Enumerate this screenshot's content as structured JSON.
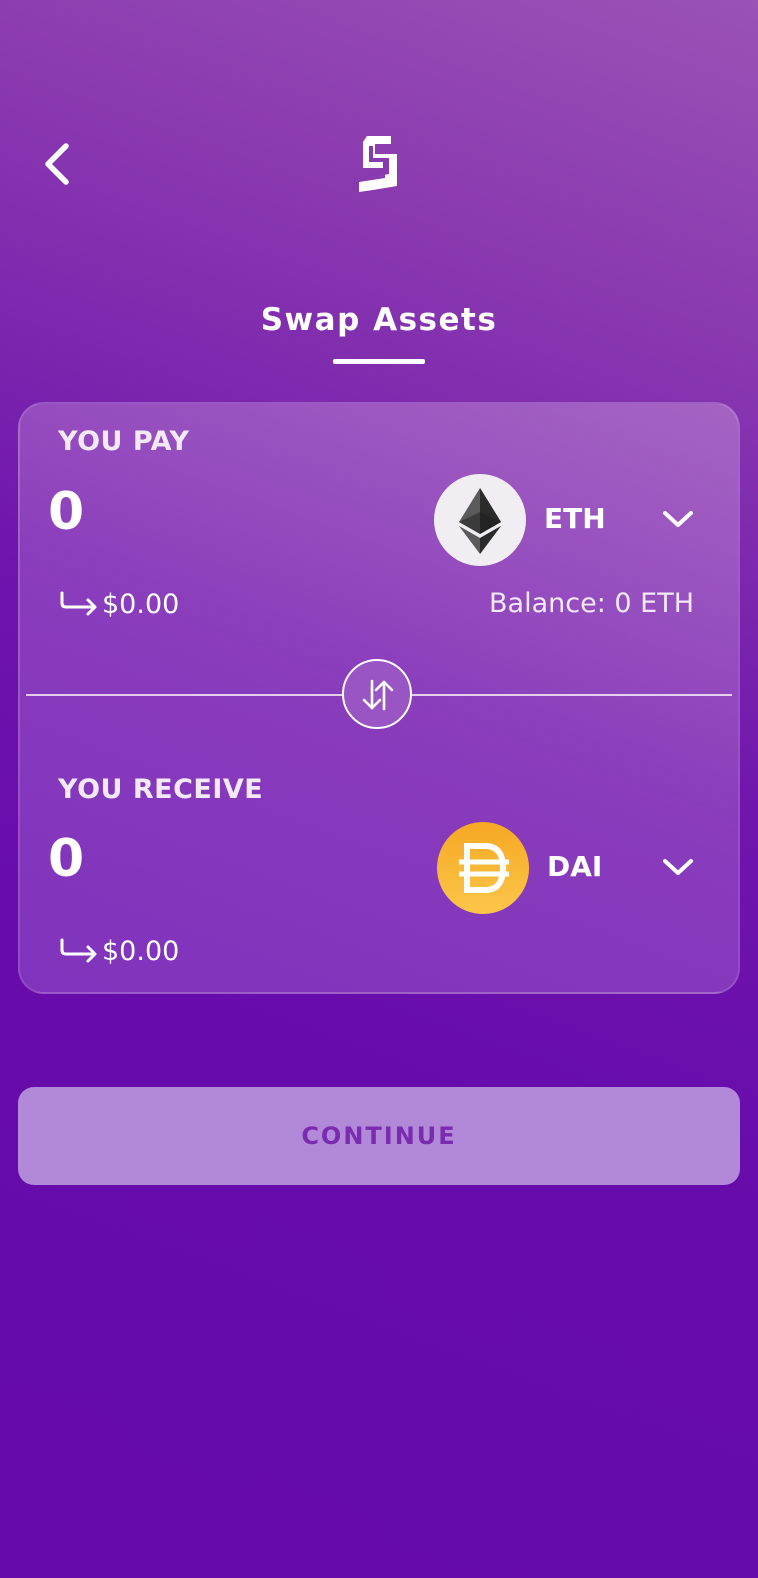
{
  "header": {
    "back_icon": "chevron-left-icon",
    "logo_icon": "app-logo-icon"
  },
  "title": "Swap Assets",
  "pay": {
    "label": "YOU PAY",
    "amount": "0",
    "token_symbol": "ETH",
    "token_icon": "ethereum-icon",
    "usd_value": "$0.00",
    "balance": "Balance: 0 ETH"
  },
  "receive": {
    "label": "YOU RECEIVE",
    "amount": "0",
    "token_symbol": "DAI",
    "token_icon": "dai-icon",
    "usd_value": "$0.00"
  },
  "swap_toggle_icon": "swap-arrows-icon",
  "continue_label": "CONTINUE",
  "colors": {
    "background_top": "#9a52b5",
    "background_bottom": "#660aab",
    "continue_bg": "#b288d8",
    "continue_text": "#7b2bb0",
    "dai_orange": "#f6a823"
  }
}
